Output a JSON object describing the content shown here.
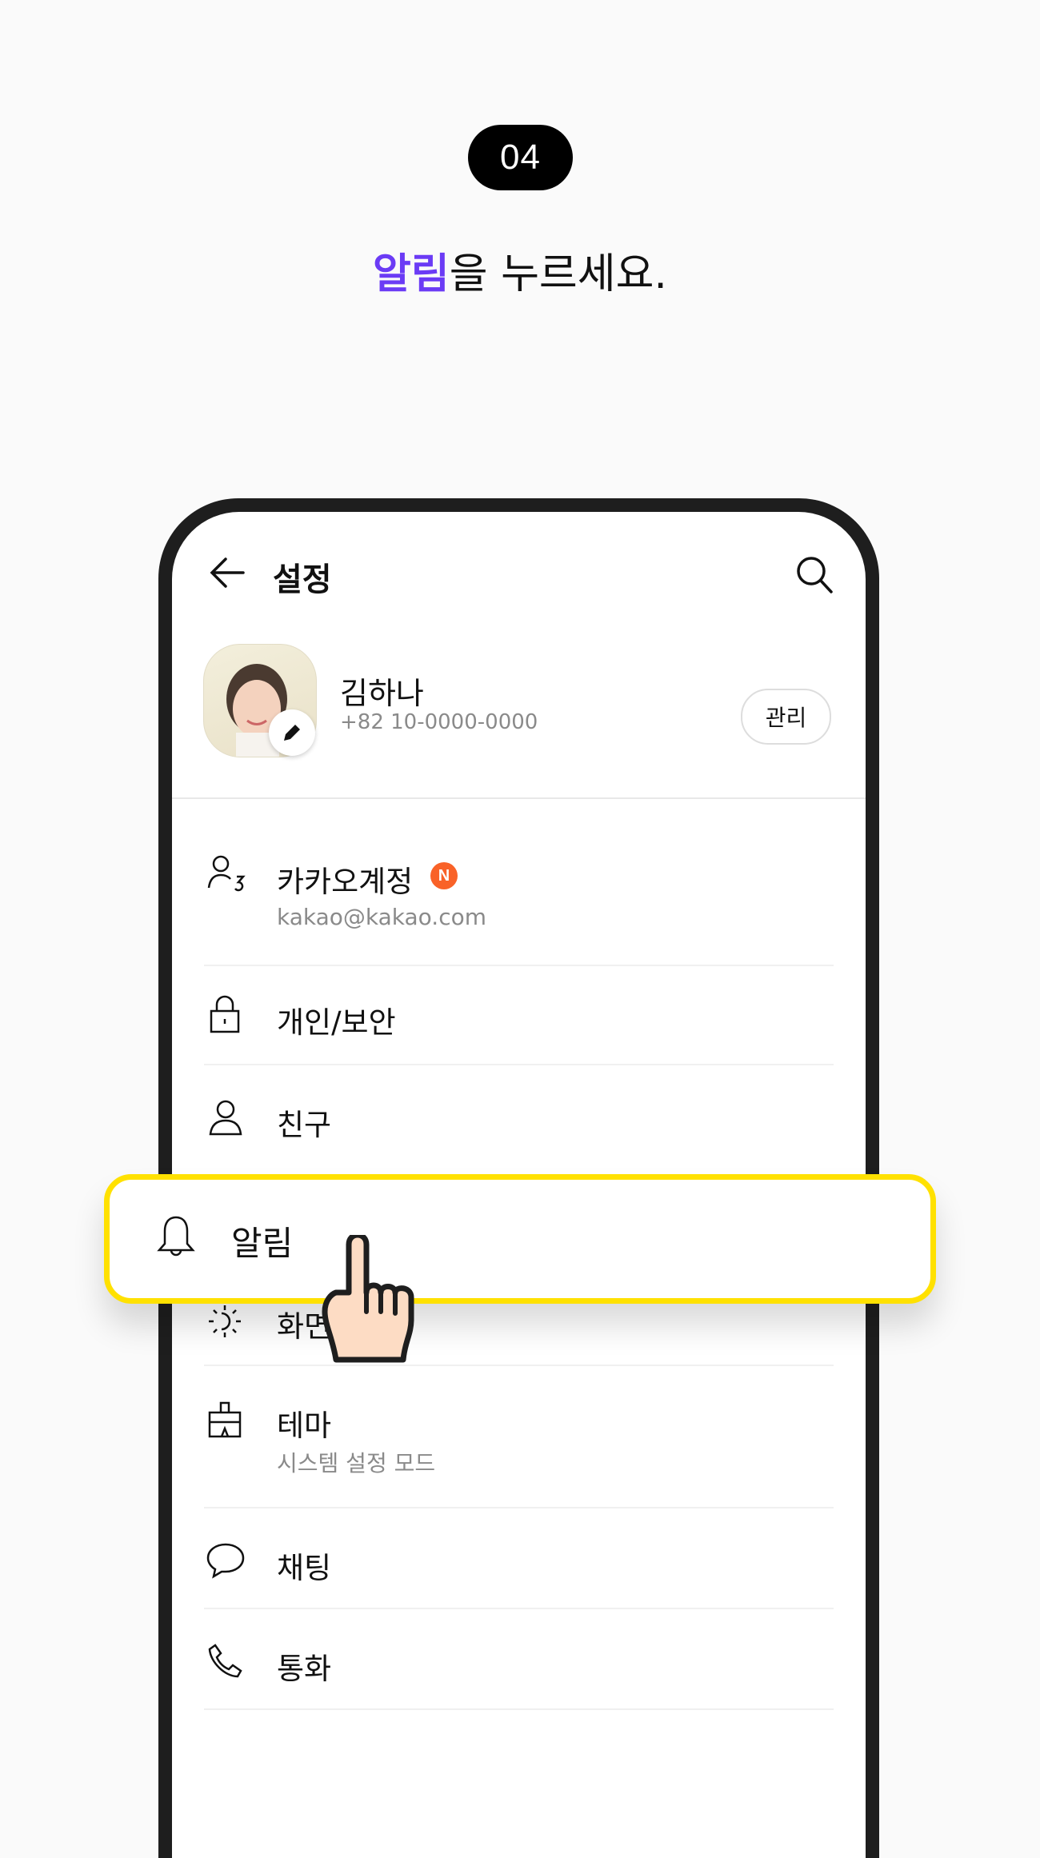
{
  "step": {
    "number": "04"
  },
  "instruction": {
    "highlight": "알림",
    "rest": "을 누르세요."
  },
  "colors": {
    "accent": "#6b3bf5",
    "highlight_border": "#ffe100",
    "new_badge": "#f96228"
  },
  "header": {
    "title": "설정",
    "back_icon": "arrow-left-icon",
    "search_icon": "search-icon"
  },
  "profile": {
    "name": "김하나",
    "phone": "+82 10-0000-0000",
    "manage_label": "관리"
  },
  "menu": [
    {
      "label": "카카오계정",
      "sub": "kakao@kakao.com",
      "icon": "account-key-icon",
      "badge": "N"
    },
    {
      "label": "개인/보안",
      "icon": "lock-icon"
    },
    {
      "label": "친구",
      "icon": "person-icon"
    },
    {
      "label": "화면",
      "icon": "sun-icon"
    },
    {
      "label": "테마",
      "sub": "시스템 설정 모드",
      "icon": "brush-icon"
    },
    {
      "label": "채팅",
      "icon": "chat-bubble-icon"
    },
    {
      "label": "통화",
      "icon": "phone-icon"
    }
  ],
  "highlighted_item": {
    "label": "알림",
    "icon": "bell-icon"
  }
}
